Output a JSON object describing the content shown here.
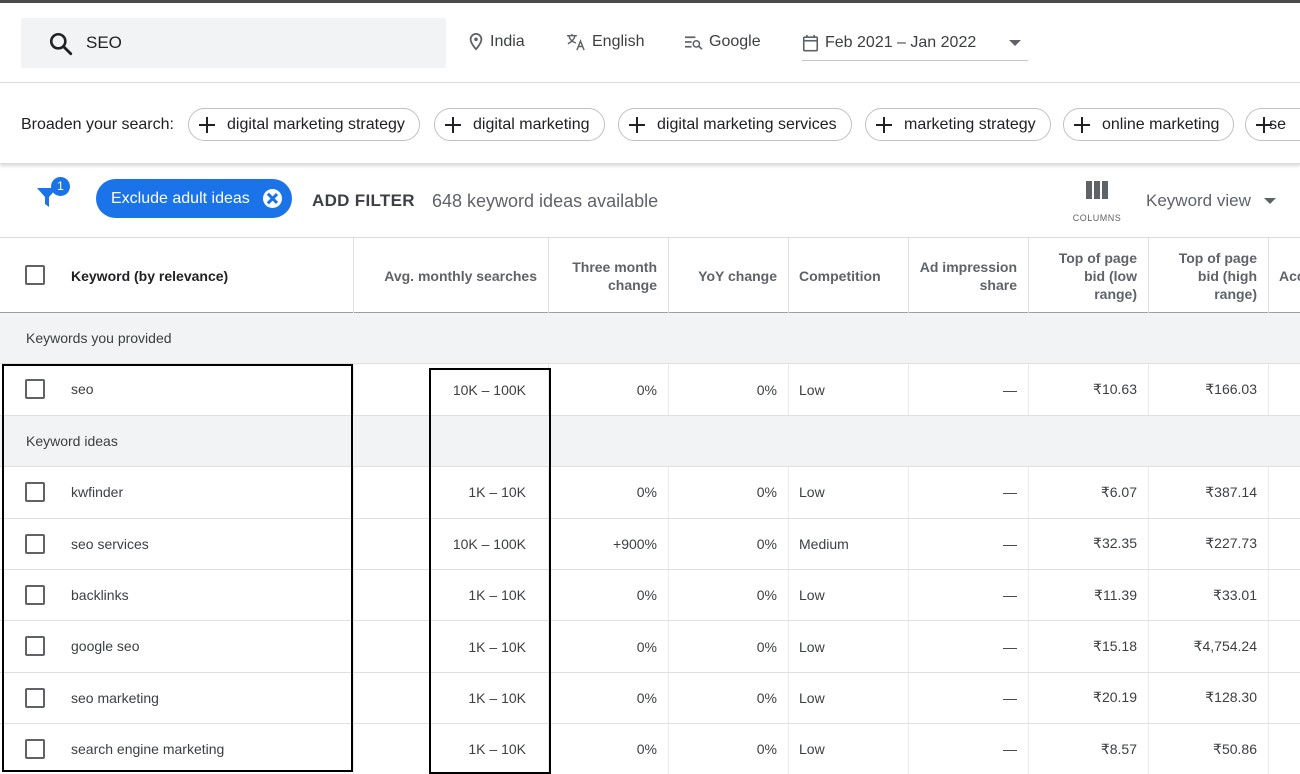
{
  "search": {
    "query": "SEO"
  },
  "top_filters": {
    "location": "India",
    "language": "English",
    "network": "Google",
    "date_range": "Feb 2021 – Jan 2022"
  },
  "broaden": {
    "label": "Broaden your search:",
    "chips": [
      "digital marketing strategy",
      "digital marketing",
      "digital marketing services",
      "marketing strategy",
      "online marketing",
      "se"
    ]
  },
  "toolbar": {
    "filter_badge": "1",
    "exclude_chip": "Exclude adult ideas",
    "add_filter": "ADD FILTER",
    "ideas_count": "648 keyword ideas available",
    "columns_label": "COLUMNS",
    "view_label": "Keyword view"
  },
  "table": {
    "headers": {
      "keyword": "Keyword (by relevance)",
      "avg": "Avg. monthly searches",
      "three_month": "Three month change",
      "yoy": "YoY change",
      "competition": "Competition",
      "ad_share": "Ad impression share",
      "bid_low": "Top of page bid (low range)",
      "bid_high": "Top of page bid (high range)",
      "acc": "Acc"
    },
    "group_provided": "Keywords you provided",
    "group_ideas": "Keyword ideas",
    "provided": [
      {
        "keyword": "seo",
        "avg": "10K – 100K",
        "three_month": "0%",
        "yoy": "0%",
        "competition": "Low",
        "ad_share": "—",
        "bid_low": "₹10.63",
        "bid_high": "₹166.03"
      }
    ],
    "ideas": [
      {
        "keyword": "kwfinder",
        "avg": "1K – 10K",
        "three_month": "0%",
        "yoy": "0%",
        "competition": "Low",
        "ad_share": "—",
        "bid_low": "₹6.07",
        "bid_high": "₹387.14"
      },
      {
        "keyword": "seo services",
        "avg": "10K – 100K",
        "three_month": "+900%",
        "yoy": "0%",
        "competition": "Medium",
        "ad_share": "—",
        "bid_low": "₹32.35",
        "bid_high": "₹227.73"
      },
      {
        "keyword": "backlinks",
        "avg": "1K – 10K",
        "three_month": "0%",
        "yoy": "0%",
        "competition": "Low",
        "ad_share": "—",
        "bid_low": "₹11.39",
        "bid_high": "₹33.01"
      },
      {
        "keyword": "google seo",
        "avg": "1K – 10K",
        "three_month": "0%",
        "yoy": "0%",
        "competition": "Low",
        "ad_share": "—",
        "bid_low": "₹15.18",
        "bid_high": "₹4,754.24"
      },
      {
        "keyword": "seo marketing",
        "avg": "1K – 10K",
        "three_month": "0%",
        "yoy": "0%",
        "competition": "Low",
        "ad_share": "—",
        "bid_low": "₹20.19",
        "bid_high": "₹128.30"
      },
      {
        "keyword": "search engine marketing",
        "avg": "1K – 10K",
        "three_month": "0%",
        "yoy": "0%",
        "competition": "Low",
        "ad_share": "—",
        "bid_low": "₹8.57",
        "bid_high": "₹50.86"
      }
    ]
  },
  "colors": {
    "accent": "#1a73e8",
    "group_bg": "#f1f3f4",
    "search_bg": "#f1f3f4"
  },
  "icons": [
    "search-icon",
    "location-pin-icon",
    "translate-icon",
    "network-icon",
    "calendar-icon",
    "plus-icon",
    "funnel-icon",
    "close-icon",
    "columns-icon",
    "chevron-down-icon",
    "checkbox-icon"
  ]
}
